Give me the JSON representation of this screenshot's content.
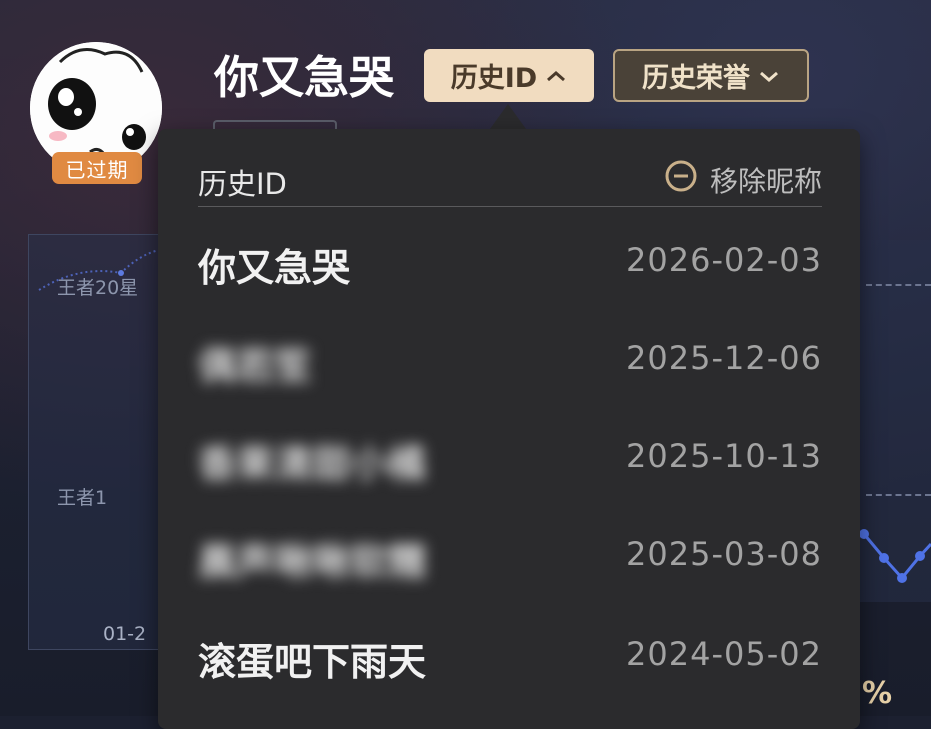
{
  "header": {
    "username": "你又急哭",
    "expired_badge": "已过期",
    "history_id_button": "历史ID",
    "history_honor_button": "历史荣誉"
  },
  "chart_bg": {
    "label_top": "王者20星",
    "label_mid": "王者1",
    "label_bottom": "01-2",
    "percent_partial": "%"
  },
  "popup": {
    "title": "历史ID",
    "remove_label": "移除昵称",
    "rows": [
      {
        "name": "你又急哭",
        "date": "2026-02-03",
        "blurred": false
      },
      {
        "name": "偶若笙",
        "date": "2025-12-06",
        "blurred": true
      },
      {
        "name": "香果清甜小橘",
        "date": "2025-10-13",
        "blurred": true
      },
      {
        "name": "晨声啾啾软糯",
        "date": "2025-03-08",
        "blurred": true
      },
      {
        "name": "滚蛋吧下雨天",
        "date": "2024-05-02",
        "blurred": false
      }
    ]
  },
  "colors": {
    "badge": "#e08a42",
    "history_id_bg": "#f1dcc0",
    "popup_bg": "#2b2b2d"
  }
}
